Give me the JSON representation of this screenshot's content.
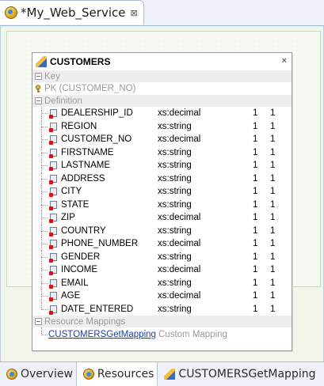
{
  "editor_tab": {
    "title": "*My_Web_Service",
    "close_glyph": "⊠",
    "icon": "web-service-icon"
  },
  "diagram": {
    "title": "CUSTOMERS",
    "close_glyph": "×",
    "icon": "table-edit-icon",
    "key_section": "Key",
    "pk_label": "PK (CUSTOMER_NO)",
    "definition_section": "Definition",
    "fields": [
      {
        "name": "DEALERSHIP_ID",
        "type": "xs:decimal",
        "min": "1",
        "max": "1"
      },
      {
        "name": "REGION",
        "type": "xs:string",
        "min": "1",
        "max": "1"
      },
      {
        "name": "CUSTOMER_NO",
        "type": "xs:decimal",
        "min": "1",
        "max": "1"
      },
      {
        "name": "FIRSTNAME",
        "type": "xs:string",
        "min": "1",
        "max": "1"
      },
      {
        "name": "LASTNAME",
        "type": "xs:string",
        "min": "1",
        "max": "1"
      },
      {
        "name": "ADDRESS",
        "type": "xs:string",
        "min": "1",
        "max": "1"
      },
      {
        "name": "CITY",
        "type": "xs:string",
        "min": "1",
        "max": "1"
      },
      {
        "name": "STATE",
        "type": "xs:string",
        "min": "1",
        "max": "1"
      },
      {
        "name": "ZIP",
        "type": "xs:decimal",
        "min": "1",
        "max": "1"
      },
      {
        "name": "COUNTRY",
        "type": "xs:string",
        "min": "1",
        "max": "1"
      },
      {
        "name": "PHONE_NUMBER",
        "type": "xs:decimal",
        "min": "1",
        "max": "1"
      },
      {
        "name": "GENDER",
        "type": "xs:string",
        "min": "1",
        "max": "1"
      },
      {
        "name": "INCOME",
        "type": "xs:decimal",
        "min": "1",
        "max": "1"
      },
      {
        "name": "EMAIL",
        "type": "xs:string",
        "min": "1",
        "max": "1"
      },
      {
        "name": "AGE",
        "type": "xs:decimal",
        "min": "1",
        "max": "1"
      },
      {
        "name": "DATE_ENTERED",
        "type": "xs:string",
        "min": "1",
        "max": "1"
      }
    ],
    "resource_mappings_section": "Resource Mappings",
    "mapping": {
      "name": "CUSTOMERSGetMapping",
      "type": "Custom Mapping"
    }
  },
  "bottom_tabs": [
    {
      "label": "Overview",
      "icon": "web-service-icon",
      "active": false
    },
    {
      "label": "Resources",
      "icon": "web-service-icon",
      "active": true
    },
    {
      "label": "CUSTOMERSGetMapping",
      "icon": "mapping-icon",
      "active": false
    }
  ]
}
